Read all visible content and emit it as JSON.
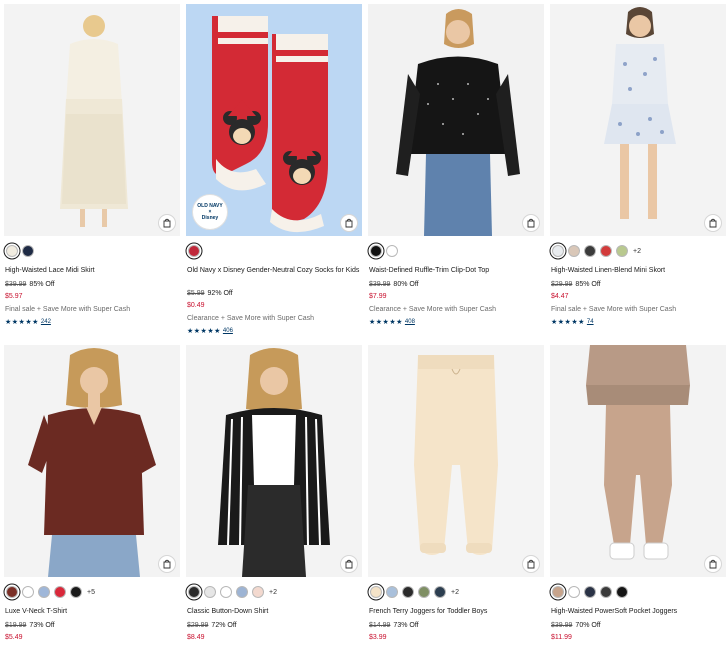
{
  "products": [
    {
      "title": "High-Waisted Lace Midi Skirt",
      "old_price": "$39.99",
      "off": "85% Off",
      "sale": "$5.97",
      "promo": "Final sale + Save More with Super Cash",
      "stars": "★★★★★",
      "reviews": "242",
      "swatches": [
        "#f1ece0",
        "#1f2b45"
      ],
      "more": ""
    },
    {
      "title": "Old Navy x Disney Gender-Neutral Cozy Socks for Kids",
      "old_price": "$5.99",
      "off": "92% Off",
      "sale": "$0.49",
      "promo": "Clearance + Save More with Super Cash",
      "stars": "★★★★★",
      "reviews": "406",
      "swatches": [
        "#c0283a"
      ],
      "more": "",
      "badge": [
        "OLD NAVY",
        "×",
        "Disney"
      ]
    },
    {
      "title": "Waist-Defined Ruffle-Trim Clip-Dot Top",
      "old_price": "$39.99",
      "off": "80% Off",
      "sale": "$7.99",
      "promo": "Clearance + Save More with Super Cash",
      "stars": "★★★★★",
      "reviews": "408",
      "swatches": [
        "#111111",
        "#ffffff"
      ],
      "more": ""
    },
    {
      "title": "High-Waisted Linen-Blend Mini Skort",
      "old_price": "$29.99",
      "off": "85% Off",
      "sale": "$4.47",
      "promo": "Final sale + Save More with Super Cash",
      "stars": "★★★★★",
      "reviews": "74",
      "swatches": [
        "#e9ecef",
        "#d9c7b8",
        "#3b3b3b",
        "#d23b3b",
        "#b9c98f"
      ],
      "more": "+2"
    },
    {
      "title": "Luxe V-Neck T-Shirt",
      "old_price": "$19.99",
      "off": "73% Off",
      "sale": "$5.49",
      "swatches": [
        "#7a2f26",
        "#ffffff",
        "#9fb7d9",
        "#d9283a",
        "#1a1a1a"
      ],
      "more": "+5"
    },
    {
      "title": "Classic Button-Down Shirt",
      "old_price": "$29.99",
      "off": "72% Off",
      "sale": "$8.49",
      "swatches": [
        "#2b2b2b",
        "#e6e6e6",
        "#ffffff",
        "#9db4d4",
        "#f3d9cf"
      ],
      "more": "+2"
    },
    {
      "title": "French Terry Joggers for Toddler Boys",
      "old_price": "$14.99",
      "off": "73% Off",
      "sale": "$3.99",
      "swatches": [
        "#f4e3c8",
        "#a9c0db",
        "#2b2b2b",
        "#7f8f64",
        "#2c3e50"
      ],
      "more": "+2"
    },
    {
      "title": "High-Waisted PowerSoft Pocket Joggers",
      "old_price": "$39.99",
      "off": "70% Off",
      "sale": "$11.99",
      "swatches": [
        "#c7a48c",
        "#ffffff",
        "#2a3346",
        "#3a3a3a",
        "#151515"
      ],
      "more": ""
    }
  ]
}
